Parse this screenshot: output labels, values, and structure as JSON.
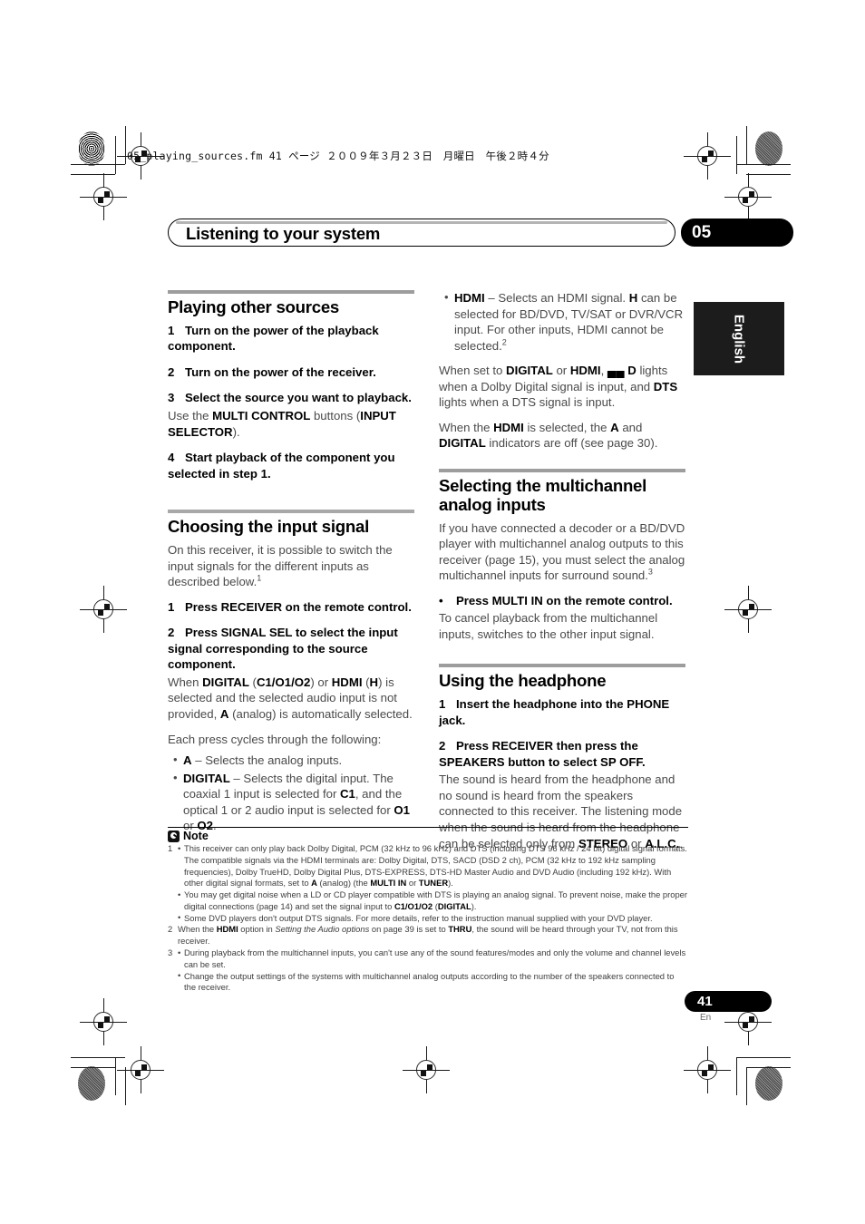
{
  "slug": "05_playing_sources.fm  41 ページ  ２００９年３月２３日　月曜日　午後２時４分",
  "header": {
    "title": "Listening to your system",
    "chapter": "05"
  },
  "side_tab": {
    "label": "English"
  },
  "page_footer": {
    "number": "41",
    "language": "En"
  },
  "left_column": {
    "section1": {
      "title": "Playing other sources",
      "steps": [
        {
          "n": "1",
          "text": "Turn on the power of the playback component."
        },
        {
          "n": "2",
          "text": "Turn on the power of the receiver."
        },
        {
          "n": "3",
          "text": "Select the source you want to playback."
        },
        {
          "n": "4",
          "text": "Start playback of the component you selected in step 1."
        }
      ],
      "step3_follow_a": "Use the ",
      "step3_bold_1": "MULTI CONTROL",
      "step3_follow_b": " buttons (",
      "step3_bold_2": "INPUT SELECTOR",
      "step3_follow_c": ")."
    },
    "section2": {
      "title": "Choosing the input signal",
      "intro": "On this receiver, it is possible to switch the input signals for the different inputs as described below.",
      "intro_sup": "1",
      "step1": {
        "n": "1",
        "text": "Press RECEIVER on the remote control."
      },
      "step2": {
        "n": "2",
        "text": "Press SIGNAL SEL to select the input signal corresponding to the source component."
      },
      "step2_follow": {
        "t1": "When ",
        "b1": "DIGITAL",
        "t2": " (",
        "b2": "C1/O1/O2",
        "t3": ") or ",
        "b3": "HDMI",
        "t4": " (",
        "b4": "H",
        "t5": ") is selected and the selected audio input is not provided, ",
        "b5": "A",
        "t6": " (analog) is automatically selected."
      },
      "cycle_lead": "Each press cycles through the following:",
      "bullets": [
        {
          "b": "A",
          "t": " – Selects the analog inputs."
        },
        {
          "b": "DIGITAL",
          "t1": " – Selects the digital input. The coaxial 1 input is selected for ",
          "b2": "C1",
          "t2": ", and the optical 1 or 2 audio input is selected for ",
          "b3": "O1",
          "t3": " or ",
          "b4": "O2",
          "t4": "."
        }
      ]
    }
  },
  "right_column": {
    "hdmi_bullet": {
      "b1": "HDMI",
      "t1": " – Selects an HDMI signal. ",
      "b2": "H",
      "t2": " can be selected for BD/DVD, TV/SAT or DVR/VCR input. For other inputs, HDMI cannot be selected.",
      "sup": "2"
    },
    "para_dolby": {
      "t1": "When set to ",
      "b1": "DIGITAL",
      "t2": " or ",
      "b2": "HDMI",
      "t3": ", ",
      "b3": "▄▄ D",
      "t4": " lights when a Dolby Digital signal is input, and ",
      "b4": "DTS",
      "t5": " lights when a DTS signal is input."
    },
    "para_hdmi_sel": {
      "t1": "When the ",
      "b1": "HDMI",
      "t2": " is selected, the ",
      "b2": "A",
      "t3": " and ",
      "b3": "DIGITAL",
      "t4": " indicators are off (see page 30)."
    },
    "section3": {
      "title": "Selecting the multichannel analog inputs",
      "intro": "If you have connected a decoder or a BD/DVD player with multichannel analog outputs to this receiver (page 15), you must select the analog multichannel inputs for surround sound.",
      "intro_sup": "3",
      "bullet_step": "Press MULTI IN on the remote control.",
      "bullet_follow": "To cancel playback from the multichannel inputs, switches to the other input signal."
    },
    "section4": {
      "title": "Using the headphone",
      "step1": {
        "n": "1",
        "text": "Insert the headphone into the PHONE jack."
      },
      "step2": {
        "n": "2",
        "text": "Press RECEIVER then press the SPEAKERS button to select SP OFF."
      },
      "step2_follow": {
        "t1": "The sound is heard from the headphone and no sound is heard from the speakers connected to this receiver. The listening mode when the sound is heard from the headphone can be selected only from ",
        "b1": "STEREO",
        "t2": " or ",
        "b2": "A.L.C.",
        "t3": "."
      }
    }
  },
  "note": {
    "label": "Note",
    "footnotes": [
      {
        "num": "1",
        "lines": [
          {
            "t1": "This receiver can only play back Dolby Digital, PCM (32 kHz to 96 kHz) and DTS (including DTS 96 kHz / 24 bit) digital signal formats. The compatible signals via the HDMI terminals are: Dolby Digital, DTS, SACD (DSD 2 ch), PCM (32 kHz to 192 kHz sampling frequencies), Dolby TrueHD, Dolby Digital Plus, DTS-EXPRESS, DTS-HD Master Audio and DVD Audio (including 192 kHz). With other digital signal formats, set to ",
            "b1": "A",
            "t2": " (analog) (the ",
            "b2": "MULTI IN",
            "t3": " or ",
            "b3": "TUNER",
            "t4": ")."
          },
          {
            "t1": "You may get digital noise when a LD or CD player compatible with DTS is playing an analog signal. To prevent noise, make the proper digital connections (page 14) and set the signal input to ",
            "b1": "C1/O1/O2",
            "t2": " (",
            "b2": "DIGITAL",
            "t3": ")."
          },
          {
            "t1": "Some DVD players don't output DTS signals. For more details, refer to the instruction manual supplied with your DVD player."
          }
        ]
      },
      {
        "num": "2",
        "lines": [
          {
            "t1": "When the ",
            "b1": "HDMI",
            "t2": " option in ",
            "i1": "Setting the Audio options",
            "t3": " on page 39 is set to ",
            "b2": "THRU",
            "t4": ", the sound will be heard through your TV, not from this receiver.",
            "nobullet": true
          }
        ]
      },
      {
        "num": "3",
        "lines": [
          {
            "t1": "During playback from the multichannel inputs, you can't use any of the sound features/modes and only the volume and channel levels can be set."
          },
          {
            "t1": "Change the output settings of the systems with multichannel analog outputs according to the number of the speakers connected to the receiver."
          }
        ]
      }
    ]
  }
}
